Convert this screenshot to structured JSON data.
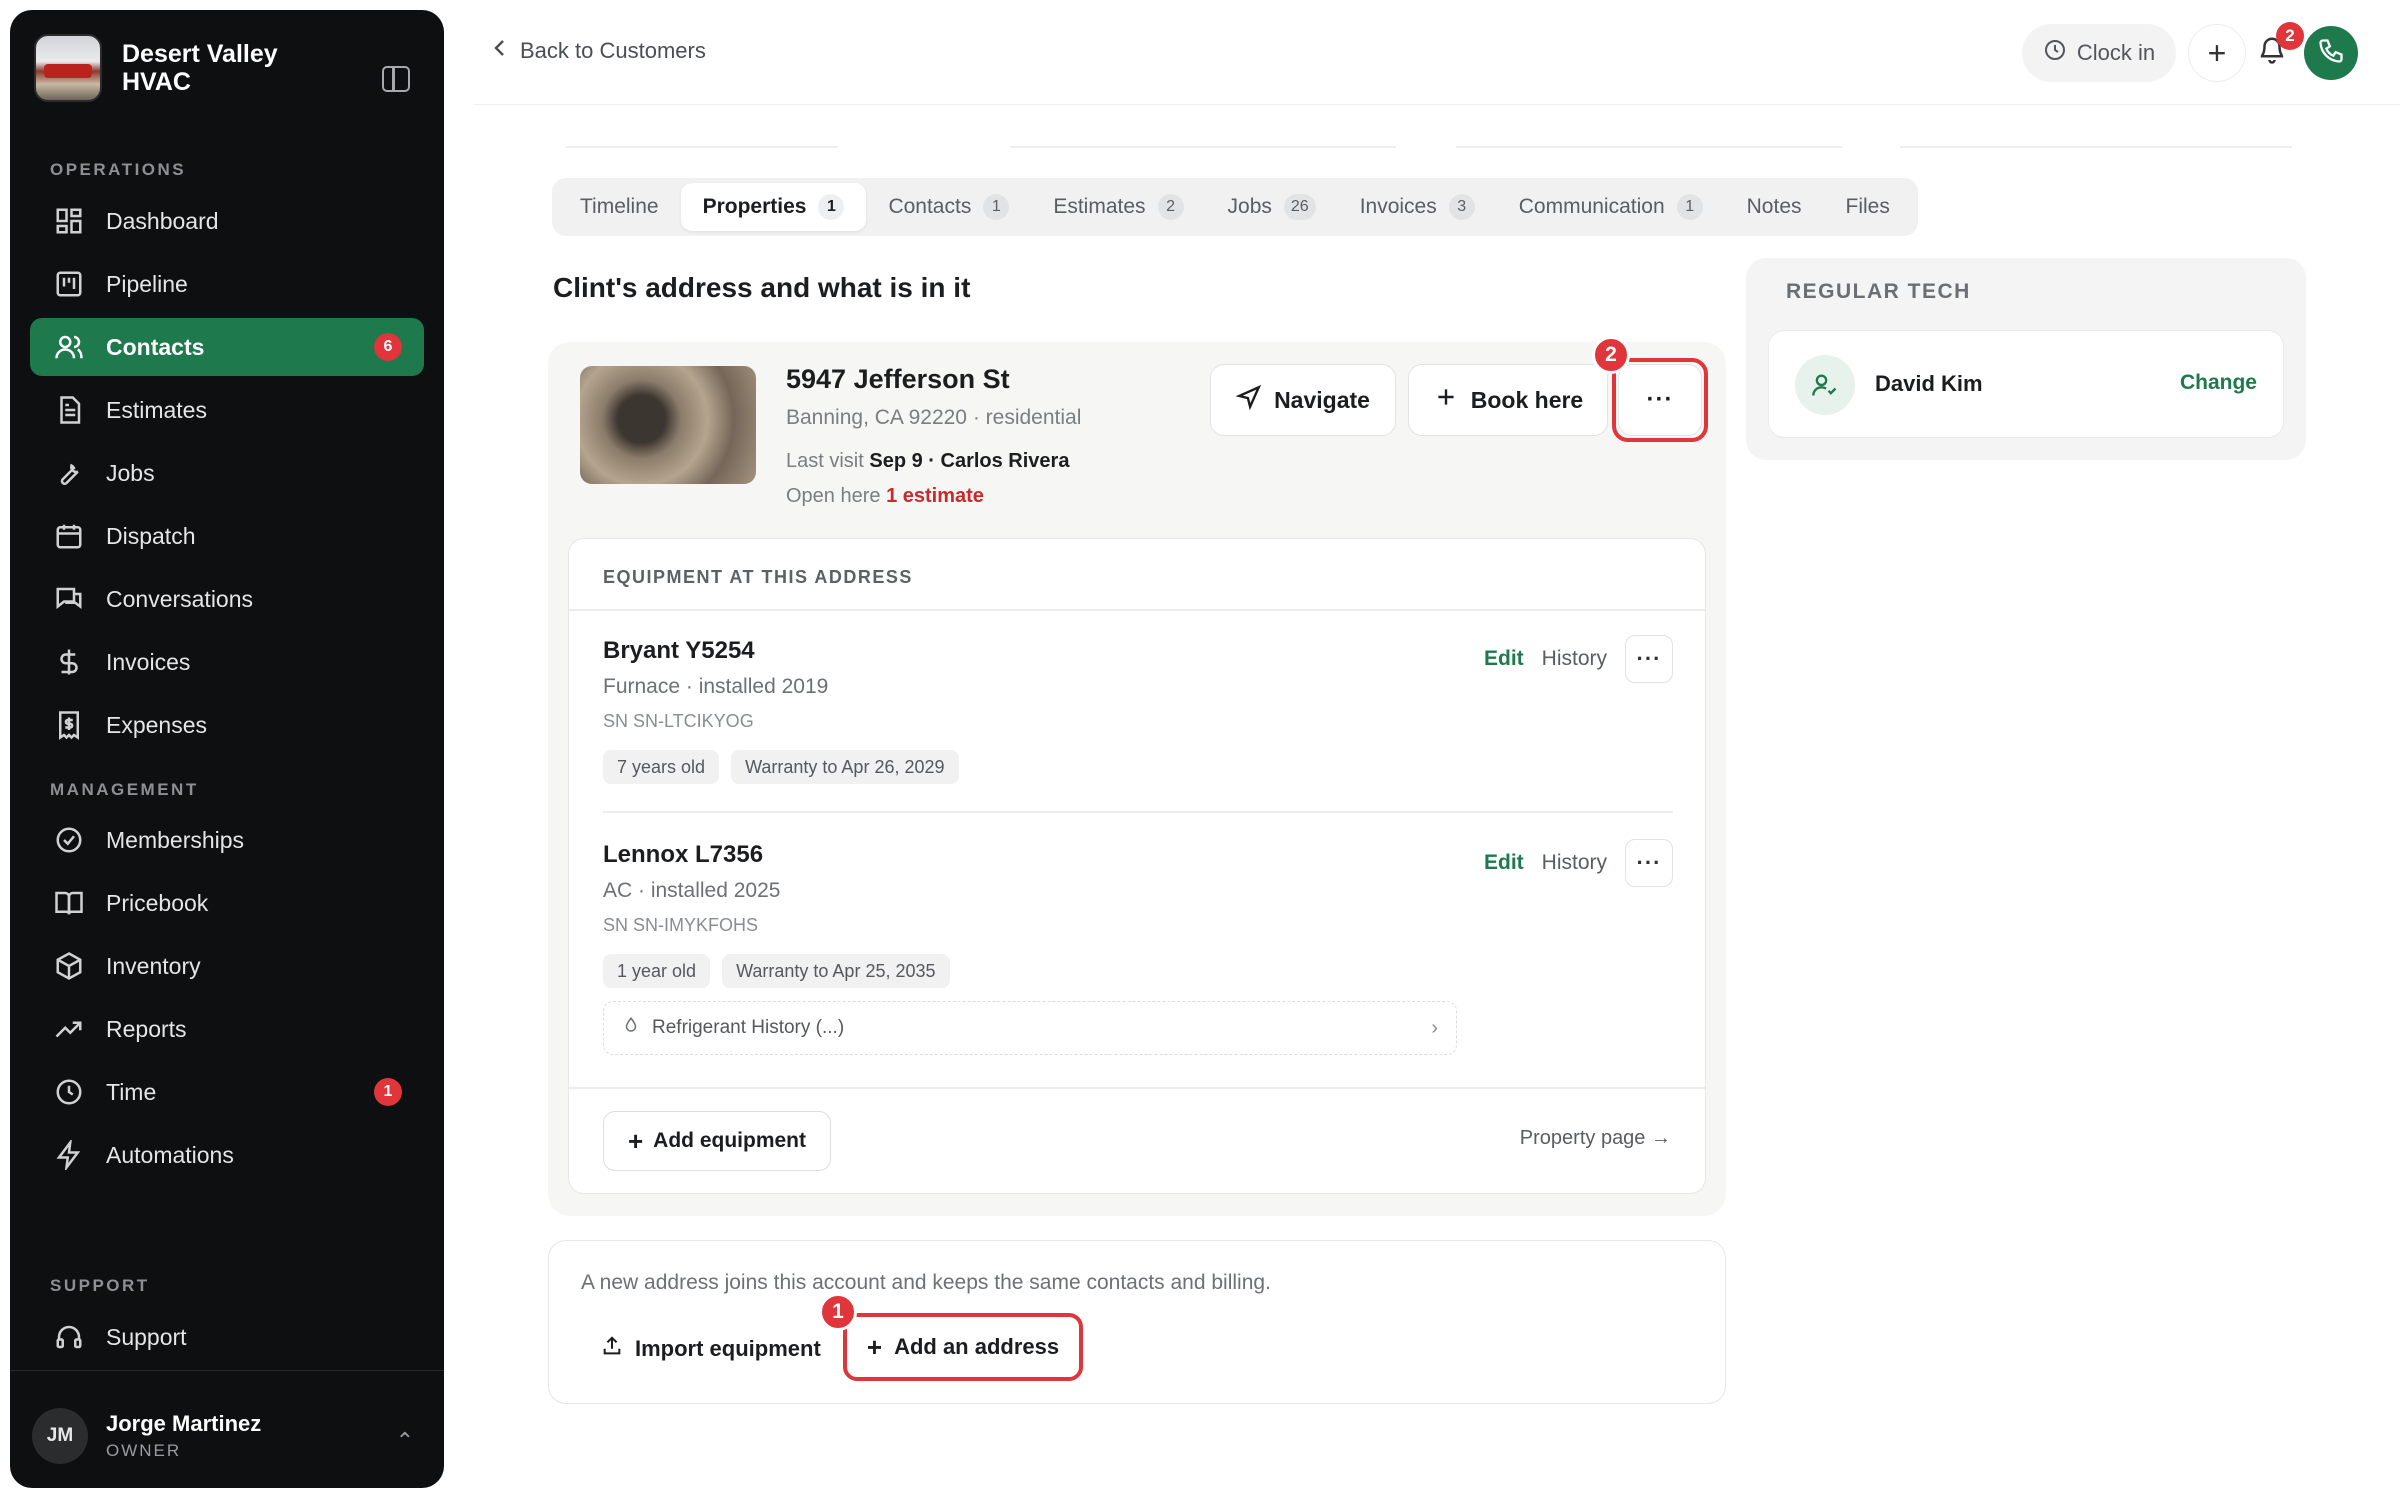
{
  "sidebar": {
    "brand": "Desert Valley HVAC",
    "sections": {
      "operations": "OPERATIONS",
      "management": "MANAGEMENT",
      "support": "SUPPORT"
    },
    "items": [
      {
        "label": "Dashboard",
        "icon": "grid-icon"
      },
      {
        "label": "Pipeline",
        "icon": "kanban-icon"
      },
      {
        "label": "Contacts",
        "icon": "users-icon",
        "badge": "6",
        "active": true
      },
      {
        "label": "Estimates",
        "icon": "file-text-icon"
      },
      {
        "label": "Jobs",
        "icon": "wrench-icon"
      },
      {
        "label": "Dispatch",
        "icon": "calendar-icon"
      },
      {
        "label": "Conversations",
        "icon": "messages-icon"
      },
      {
        "label": "Invoices",
        "icon": "dollar-icon"
      },
      {
        "label": "Expenses",
        "icon": "receipt-icon"
      },
      {
        "label": "Memberships",
        "icon": "badge-check-icon"
      },
      {
        "label": "Pricebook",
        "icon": "book-icon"
      },
      {
        "label": "Inventory",
        "icon": "box-icon"
      },
      {
        "label": "Reports",
        "icon": "trending-icon"
      },
      {
        "label": "Time",
        "icon": "clock-icon",
        "badge": "1"
      },
      {
        "label": "Automations",
        "icon": "zap-icon"
      },
      {
        "label": "Support",
        "icon": "headset-icon"
      }
    ],
    "user": {
      "initials": "JM",
      "name": "Jorge Martinez",
      "role": "OWNER"
    }
  },
  "topbar": {
    "back": "Back to Customers",
    "clock_in": "Clock in",
    "notification_count": "2"
  },
  "tabs": [
    {
      "label": "Timeline",
      "count": ""
    },
    {
      "label": "Properties",
      "count": "1",
      "active": true
    },
    {
      "label": "Contacts",
      "count": "1"
    },
    {
      "label": "Estimates",
      "count": "2"
    },
    {
      "label": "Jobs",
      "count": "26"
    },
    {
      "label": "Invoices",
      "count": "3"
    },
    {
      "label": "Communication",
      "count": "1"
    },
    {
      "label": "Notes",
      "count": ""
    },
    {
      "label": "Files",
      "count": ""
    }
  ],
  "heading": "Clint's address and what is in it",
  "property": {
    "address": "5947 Jefferson St",
    "subline": "Banning, CA 92220 · residential",
    "last_visit_label": "Last visit",
    "last_visit_value": "Sep 9 · Carlos Rivera",
    "open_here_label": "Open here",
    "open_here_value": "1 estimate",
    "navigate": "Navigate",
    "book_here": "Book here",
    "more": "···",
    "more_step": "2"
  },
  "equipment": {
    "heading": "EQUIPMENT AT THIS ADDRESS",
    "edit": "Edit",
    "history": "History",
    "items": [
      {
        "name": "Bryant Y5254",
        "meta": "Furnace · installed 2019",
        "serial": "SN SN-LTCIKYOG",
        "chips": [
          "7 years old",
          "Warranty to Apr 26, 2029"
        ]
      },
      {
        "name": "Lennox L7356",
        "meta": "AC · installed 2025",
        "serial": "SN SN-IMYKFOHS",
        "chips": [
          "1 year old",
          "Warranty to Apr 25, 2035"
        ]
      }
    ],
    "refrigerant": "Refrigerant History (...)",
    "add": "Add equipment",
    "property_page": "Property page →"
  },
  "new_address": {
    "note": "A new address joins this account and keeps the same contacts and billing.",
    "import": "Import equipment",
    "add": "Add an address",
    "add_step": "1"
  },
  "regular_tech": {
    "label": "REGULAR TECH",
    "name": "David Kim",
    "change": "Change"
  },
  "colors": {
    "brand_green": "#1e7a4d",
    "alert_red": "#e0353b",
    "sidebar_bg": "#0e0f10"
  }
}
